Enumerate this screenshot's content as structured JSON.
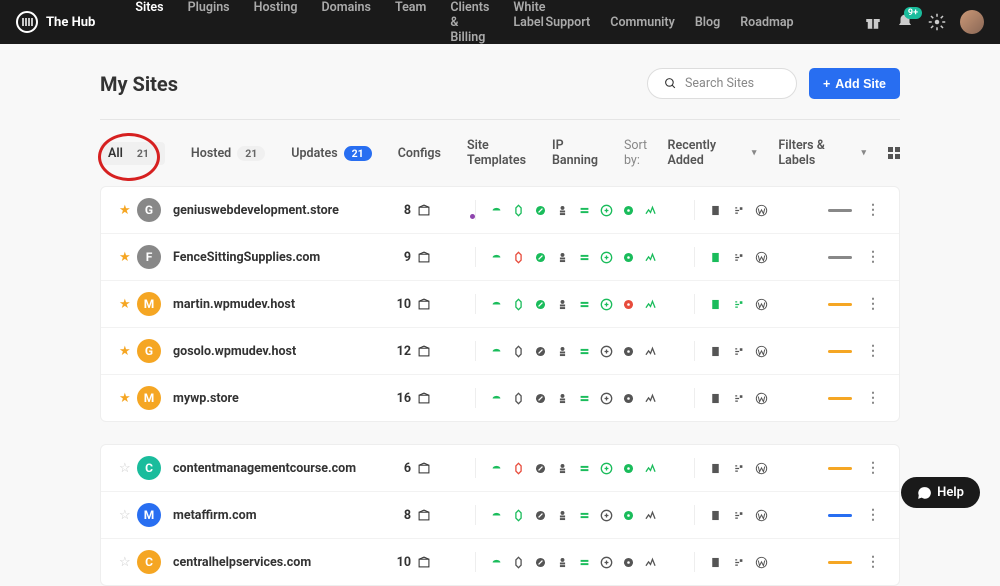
{
  "brand": "The Hub",
  "nav": {
    "left": [
      "Sites",
      "Plugins",
      "Hosting",
      "Domains",
      "Team",
      "Clients & Billing",
      "White Label"
    ],
    "right": [
      "Support",
      "Community",
      "Blog",
      "Roadmap"
    ],
    "active": 0
  },
  "notifications_badge": "9+",
  "page_title": "My Sites",
  "search": {
    "placeholder": "Search Sites"
  },
  "add_site_label": "Add Site",
  "tabs": [
    {
      "label": "All",
      "count": "21",
      "active": true,
      "pill_blue": false
    },
    {
      "label": "Hosted",
      "count": "21"
    },
    {
      "label": "Updates",
      "count": "21",
      "pill_blue": true
    },
    {
      "label": "Configs"
    },
    {
      "label": "Site Templates"
    },
    {
      "label": "IP Banning"
    }
  ],
  "sort": {
    "label": "Sort by:",
    "value": "Recently Added"
  },
  "filters_label": "Filters & Labels",
  "help_label": "Help",
  "colors": {
    "green": "#1abc5b",
    "red": "#e74c3c",
    "orange": "#f5a623",
    "gray": "#999",
    "dark": "#555",
    "blue": "#286ef1",
    "teal": "#1abc9c"
  },
  "sites_group1": [
    {
      "letter": "G",
      "avatar_bg": "#888",
      "name": "geniuswebdevelopment.store",
      "count": "8",
      "star": true,
      "svc": [
        "green",
        "green",
        "green",
        "dark",
        "green",
        "green",
        "green",
        "green"
      ],
      "meta": [
        "dark",
        "dark",
        "dark"
      ],
      "dot": "#8e44ad",
      "status": "#888"
    },
    {
      "letter": "F",
      "avatar_bg": "#888",
      "name": "FenceSittingSupplies.com",
      "count": "9",
      "star": true,
      "svc": [
        "green",
        "red",
        "green",
        "dark",
        "green",
        "green",
        "green",
        "green"
      ],
      "meta": [
        "green",
        "dark",
        "dark"
      ],
      "status": "#888"
    },
    {
      "letter": "M",
      "avatar_bg": "#f5a623",
      "name": "martin.wpmudev.host",
      "count": "10",
      "star": true,
      "svc": [
        "green",
        "green",
        "green",
        "dark",
        "green",
        "green",
        "red",
        "green"
      ],
      "meta": [
        "green",
        "green",
        "dark"
      ],
      "status": "#f5a623"
    },
    {
      "letter": "G",
      "avatar_bg": "#f5a623",
      "name": "gosolo.wpmudev.host",
      "count": "12",
      "star": true,
      "svc": [
        "green",
        "dark",
        "dark",
        "dark",
        "green",
        "dark",
        "dark",
        "dark"
      ],
      "meta": [
        "dark",
        "dark",
        "dark"
      ],
      "status": "#f5a623"
    },
    {
      "letter": "M",
      "avatar_bg": "#f5a623",
      "name": "mywp.store",
      "count": "16",
      "star": true,
      "svc": [
        "green",
        "dark",
        "dark",
        "dark",
        "green",
        "dark",
        "dark",
        "dark"
      ],
      "meta": [
        "dark",
        "dark",
        "dark"
      ],
      "status": "#f5a623"
    }
  ],
  "sites_group2": [
    {
      "letter": "C",
      "avatar_bg": "#1abc9c",
      "name": "contentmanagementcourse.com",
      "count": "6",
      "star": false,
      "svc": [
        "green",
        "red",
        "dark",
        "dark",
        "green",
        "green",
        "green",
        "green"
      ],
      "meta": [
        "dark",
        "dark",
        "dark"
      ],
      "status": "#f5a623"
    },
    {
      "letter": "M",
      "avatar_bg": "#286ef1",
      "name": "metaffirm.com",
      "count": "8",
      "star": false,
      "svc": [
        "green",
        "green",
        "dark",
        "dark",
        "green",
        "dark",
        "green",
        "dark"
      ],
      "meta": [
        "dark",
        "dark",
        "dark"
      ],
      "status": "#286ef1"
    },
    {
      "letter": "C",
      "avatar_bg": "#f5a623",
      "name": "centralhelpservices.com",
      "count": "10",
      "star": false,
      "svc": [
        "green",
        "dark",
        "dark",
        "dark",
        "green",
        "dark",
        "dark",
        "dark"
      ],
      "meta": [
        "dark",
        "dark",
        "dark"
      ],
      "status": "#f5a623"
    }
  ]
}
